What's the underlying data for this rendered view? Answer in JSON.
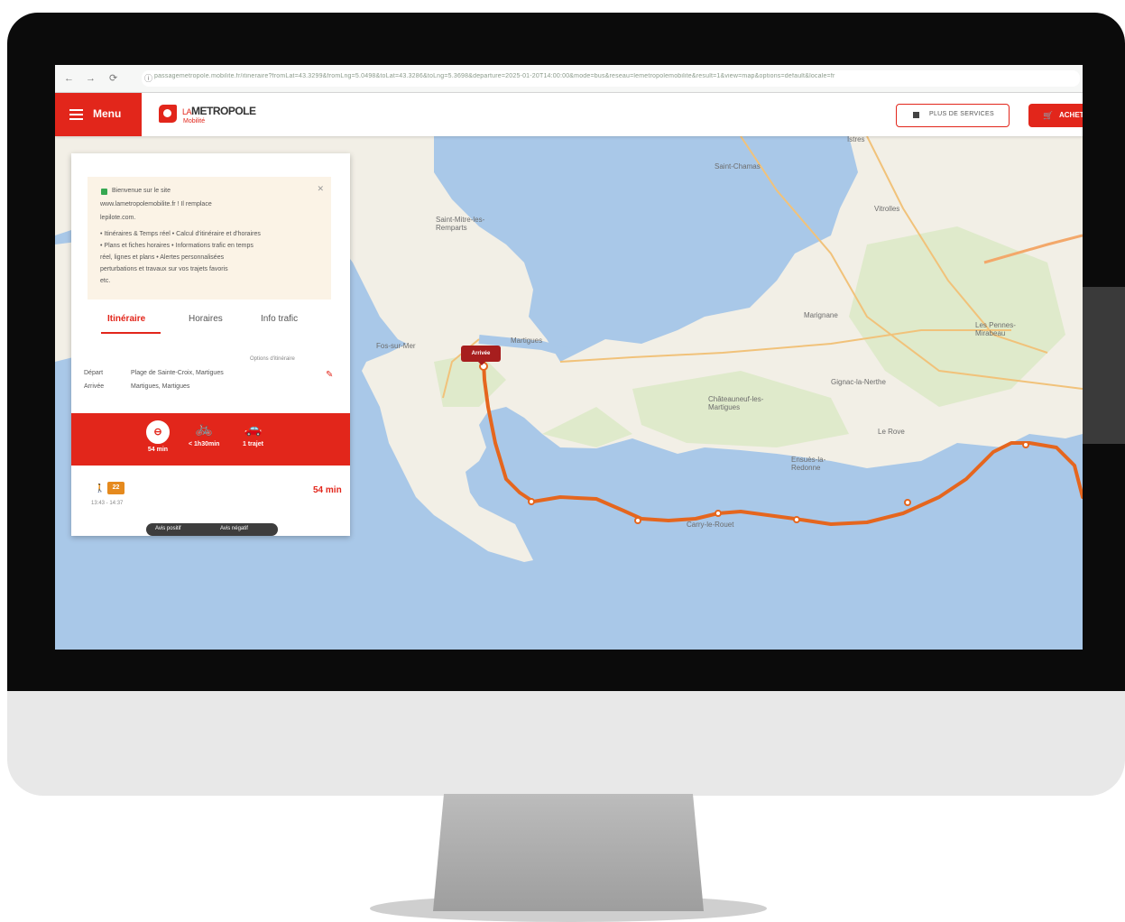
{
  "browser": {
    "back": "←",
    "forward": "→",
    "reload": "⟳",
    "info": "ⓘ",
    "url": "passagemetropole.mobilite.fr/itineraire?fromLat=43.3299&fromLng=5.0498&toLat=43.3286&toLng=5.3698&departure=2025-01-20T14:00:00&mode=bus&reseau=lemetropolemobilite&result=1&view=map&options=default&locale=fr"
  },
  "header": {
    "menu_label": "Menu",
    "logo_la": "LA",
    "logo_name": "METROPOLE",
    "logo_sub": "Mobilité",
    "outline_button": "PLUS DE SERVICES",
    "buy_button": "ACHETER"
  },
  "notice": {
    "title": "Bienvenue sur le site",
    "lines": [
      "www.lametropolemobilite.fr ! Il remplace",
      "lepilote.com.",
      "• Itinéraires & Temps réel • Calcul d'itinéraire et d'horaires",
      "• Plans et fiches horaires • Informations trafic en temps",
      "réel, lignes et plans • Alertes personnalisées",
      "perturbations et travaux sur vos trajets favoris",
      "etc."
    ]
  },
  "tabs": [
    "Itinéraire",
    "Horaires",
    "Info trafic"
  ],
  "trip": {
    "options_link": "Options d'itinéraire",
    "depart_label": "Départ",
    "depart_value": "Plage de Sainte-Croix, Martigues",
    "arrival_label": "Arrivée",
    "arrival_value": "Martigues, Martigues"
  },
  "modes": [
    {
      "icon": "bus-icon",
      "glyph": "⊖",
      "label": "54 min"
    },
    {
      "icon": "bike-icon",
      "glyph": "🚲",
      "label": "< 1h30min"
    },
    {
      "icon": "car-icon",
      "glyph": "🚗",
      "label": "1 trajet"
    }
  ],
  "result": {
    "walk": "🚶",
    "line": "22",
    "times": "13:43 - 14:37",
    "duration": "54 min"
  },
  "feedback": {
    "left": "Avis positif",
    "right": "Avis négatif"
  },
  "route_tag": "Arrivée",
  "map_labels": {
    "l1": "Saint-Chamas",
    "l2": "Istres",
    "l3": "Saint-Mitre-les-Remparts",
    "l4": "Martigues",
    "l5": "Marignane",
    "l6": "Châteauneuf-les-Martigues",
    "l7": "Ensuès-la-Redonne",
    "l8": "Carry-le-Rouet",
    "l9": "Les Pennes-Mirabeau",
    "l10": "Vitrolles",
    "l11": "Gignac-la-Nerthe",
    "l12": "Le Rove",
    "l13": "Fos-sur-Mer"
  },
  "colors": {
    "brand_red": "#e2261b",
    "route_orange": "#e5661e",
    "sea": "#a9c8e8",
    "land": "#f2efe6"
  }
}
